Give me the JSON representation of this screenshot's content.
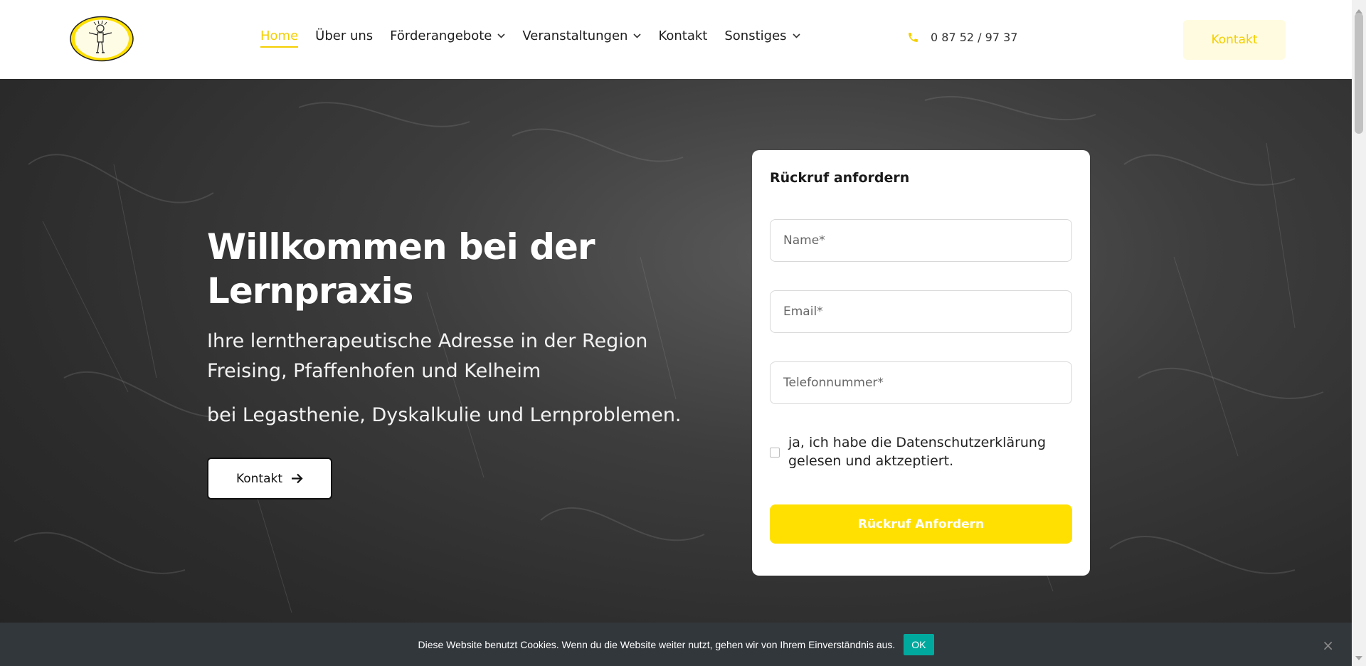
{
  "header": {
    "logo_icon": "child-drawing-logo",
    "nav": [
      {
        "label": "Home",
        "active": true,
        "dropdown": false
      },
      {
        "label": "Über uns",
        "active": false,
        "dropdown": false
      },
      {
        "label": "Förderangebote",
        "active": false,
        "dropdown": true
      },
      {
        "label": "Veranstaltungen",
        "active": false,
        "dropdown": true
      },
      {
        "label": "Kontakt",
        "active": false,
        "dropdown": false
      },
      {
        "label": "Sonstiges",
        "active": false,
        "dropdown": true
      }
    ],
    "phone": "0 87 52 / 97 37",
    "contact_button": "Kontakt"
  },
  "hero": {
    "title": "Willkommen bei der Lernpraxis",
    "subtitle": "Ihre lerntherapeutische Adresse in der Region Freising, Pfaffenhofen und Kelheim",
    "subtitle2": "bei Legasthenie, Dyskalkulie und Lernproblemen.",
    "button": "Kontakt"
  },
  "form": {
    "title": "Rückruf anfordern",
    "name_placeholder": "Name*",
    "email_placeholder": "Email*",
    "phone_placeholder": "Telefonnummer*",
    "consent": "ja, ich habe die Datenschutzerklärung gelesen und aktzeptiert.",
    "submit": "Rückruf Anfordern"
  },
  "cookie": {
    "text": "Diese Website benutzt Cookies. Wenn du die Website weiter nutzt, gehen wir von Ihrem Einverständnis aus.",
    "ok": "OK",
    "close": "×"
  },
  "colors": {
    "accent": "#f4cf00",
    "button_yellow": "#ffe000",
    "cookie_bg": "#32373c",
    "cookie_ok": "#00a99d"
  }
}
